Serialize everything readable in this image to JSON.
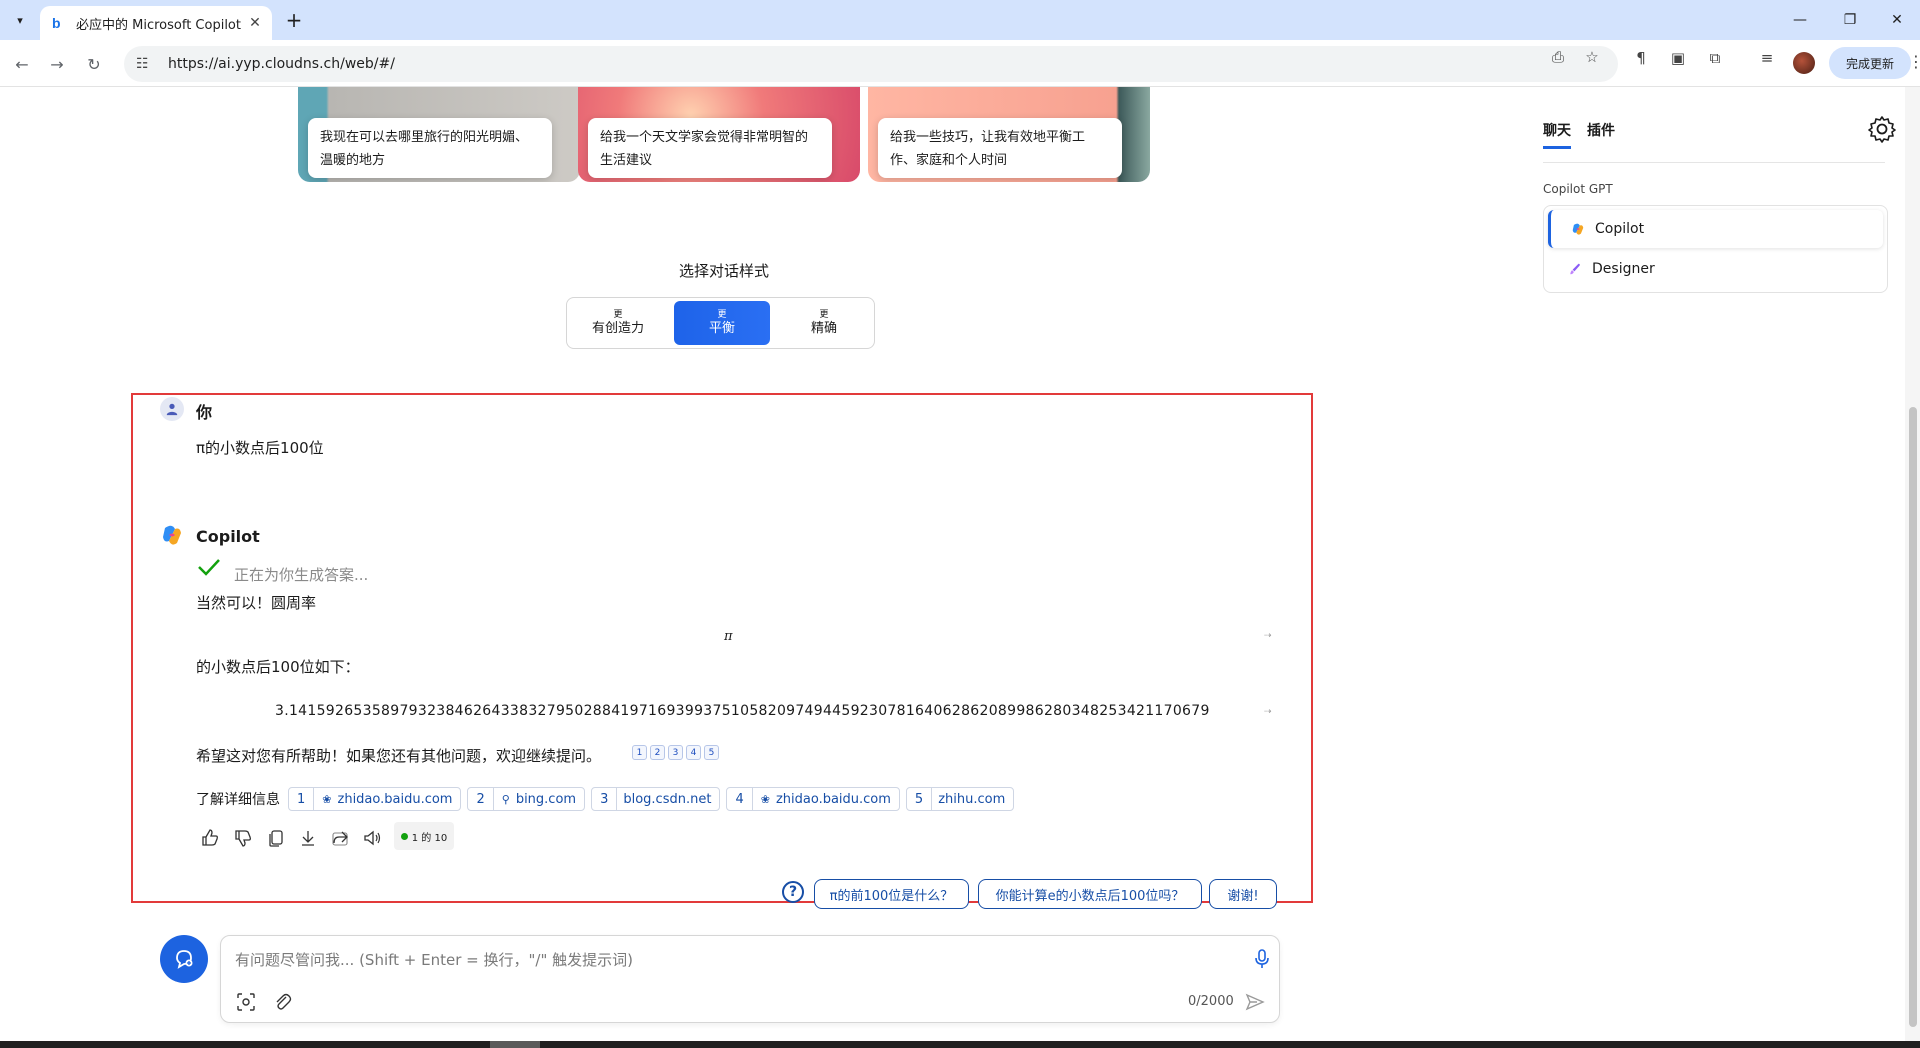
{
  "browser": {
    "tab_title": "必应中的 Microsoft Copilot",
    "url": "https://ai.yyp.cloudns.ch/web/#/",
    "update_button": "完成更新"
  },
  "cards": [
    {
      "text": "我现在可以去哪里旅行的阳光明媚、温暖的地方"
    },
    {
      "text": "给我一个天文学家会觉得非常明智的生活建议"
    },
    {
      "text": "给我一些技巧，让我有效地平衡工作、家庭和个人时间"
    }
  ],
  "style_picker": {
    "title": "选择对话样式",
    "options": [
      {
        "small": "更",
        "label": "有创造力"
      },
      {
        "small": "更",
        "label": "平衡"
      },
      {
        "small": "更",
        "label": "精确"
      }
    ]
  },
  "user_message": {
    "name": "你",
    "text": "π的小数点后100位"
  },
  "copilot_message": {
    "name": "Copilot",
    "status": "正在为你生成答案...",
    "line1": "当然可以！圆周率",
    "pi_symbol": "π",
    "line2": "的小数点后100位如下：",
    "digits": "3.1415926535897932384626433832795028841971693993751058209749445923078164062862089986280348253421170679",
    "line3": "希望这对您有所帮助！如果您还有其他问题，欢迎继续提问。",
    "citations": [
      "1",
      "2",
      "3",
      "4",
      "5"
    ],
    "learn_more_label": "了解详细信息",
    "sources": [
      {
        "num": "1",
        "domain": "zhidao.baidu.com"
      },
      {
        "num": "2",
        "domain": "bing.com"
      },
      {
        "num": "3",
        "domain": "blog.csdn.net"
      },
      {
        "num": "4",
        "domain": "zhidao.baidu.com"
      },
      {
        "num": "5",
        "domain": "zhihu.com"
      }
    ],
    "counter": "1 的 10"
  },
  "suggestions": [
    "π的前100位是什么？",
    "你能计算e的小数点后100位吗？",
    "谢谢!"
  ],
  "input": {
    "placeholder": "有问题尽管问我... (Shift + Enter = 换行，\"/\" 触发提示词)",
    "char_count": "0/2000"
  },
  "sidebar": {
    "tabs": [
      "聊天",
      "插件"
    ],
    "gpt_label": "Copilot GPT",
    "gpts": [
      "Copilot",
      "Designer"
    ]
  },
  "colors": {
    "accent": "#1d63e0",
    "highlight_border": "#e23a3a",
    "chrome_tabbar": "#d3e3fd"
  }
}
